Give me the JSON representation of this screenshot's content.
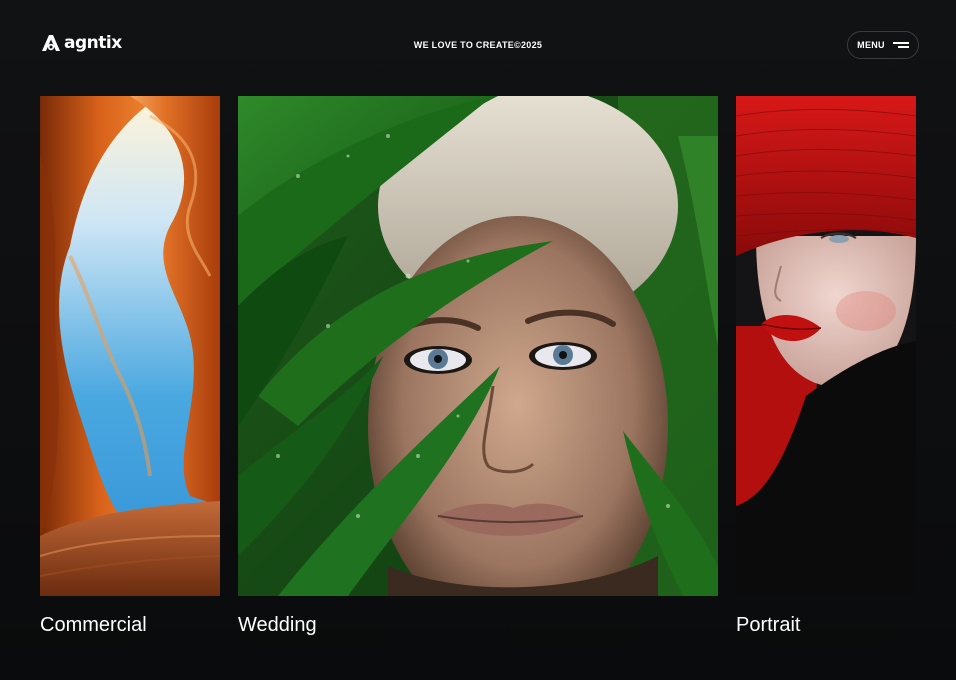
{
  "header": {
    "logo_text": "agntix",
    "logo_icon": "a-logo-icon",
    "tagline": "WE LOVE TO CREATE©2025",
    "menu_label": "MENU",
    "menu_icon": "hamburger-icon"
  },
  "gallery": {
    "items": [
      {
        "label": "Commercial",
        "image": "orange canyon rock formation with blue sky"
      },
      {
        "label": "Wedding",
        "image": "woman face framed by green wet leaves"
      },
      {
        "label": "Portrait",
        "image": "woman in red wide-brim hat with red lips"
      }
    ]
  },
  "colors": {
    "background": "#0d0e10",
    "text": "#ffffff",
    "menu_border": "#3a3c40"
  }
}
